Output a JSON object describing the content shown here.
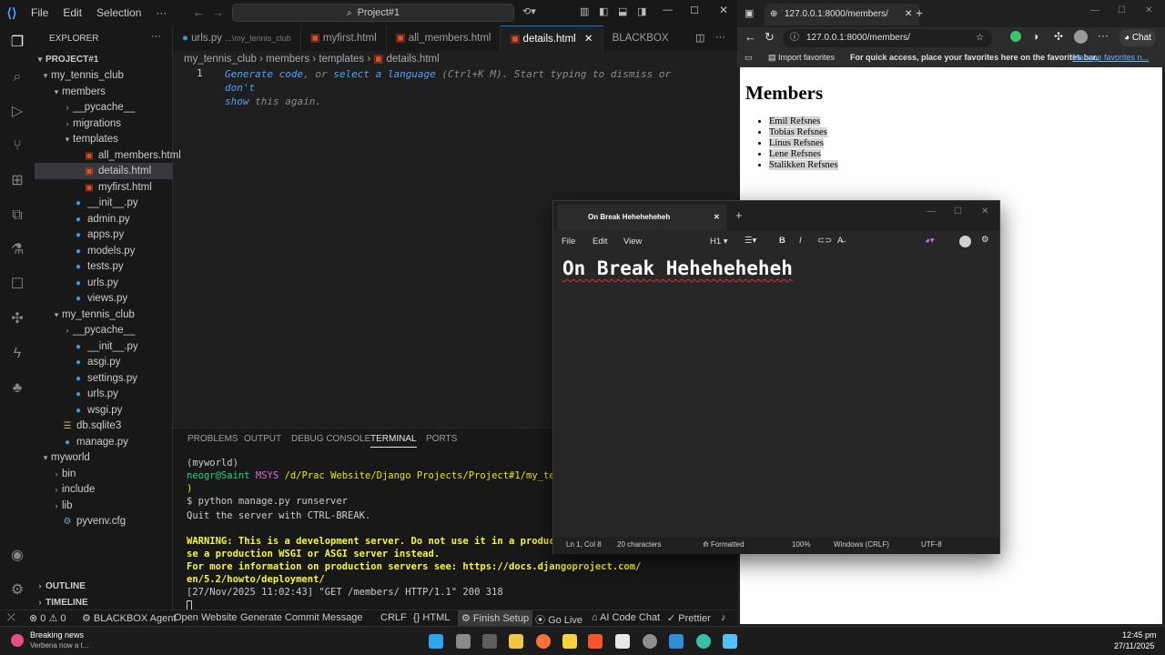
{
  "vscode": {
    "menu": [
      "File",
      "Edit",
      "Selection",
      "···"
    ],
    "search_text": "Project#1",
    "explorer_label": "EXPLORER",
    "project_root": "PROJECT#1",
    "tree": [
      {
        "label": "my_tennis_club",
        "depth": 1,
        "type": "folder",
        "open": true
      },
      {
        "label": "members",
        "depth": 2,
        "type": "folder",
        "open": true
      },
      {
        "label": "__pycache__",
        "depth": 3,
        "type": "folder",
        "open": false
      },
      {
        "label": "migrations",
        "depth": 3,
        "type": "folder",
        "open": false
      },
      {
        "label": "templates",
        "depth": 3,
        "type": "folder",
        "open": true
      },
      {
        "label": "all_members.html",
        "depth": 4,
        "type": "html"
      },
      {
        "label": "details.html",
        "depth": 4,
        "type": "html",
        "selected": true
      },
      {
        "label": "myfirst.html",
        "depth": 4,
        "type": "html"
      },
      {
        "label": "__init__.py",
        "depth": 3,
        "type": "py"
      },
      {
        "label": "admin.py",
        "depth": 3,
        "type": "py"
      },
      {
        "label": "apps.py",
        "depth": 3,
        "type": "py"
      },
      {
        "label": "models.py",
        "depth": 3,
        "type": "py"
      },
      {
        "label": "tests.py",
        "depth": 3,
        "type": "py"
      },
      {
        "label": "urls.py",
        "depth": 3,
        "type": "py"
      },
      {
        "label": "views.py",
        "depth": 3,
        "type": "py"
      },
      {
        "label": "my_tennis_club",
        "depth": 2,
        "type": "folder",
        "open": true
      },
      {
        "label": "__pycache__",
        "depth": 3,
        "type": "folder",
        "open": false
      },
      {
        "label": "__init__.py",
        "depth": 3,
        "type": "py"
      },
      {
        "label": "asgi.py",
        "depth": 3,
        "type": "py"
      },
      {
        "label": "settings.py",
        "depth": 3,
        "type": "py"
      },
      {
        "label": "urls.py",
        "depth": 3,
        "type": "py"
      },
      {
        "label": "wsgi.py",
        "depth": 3,
        "type": "py"
      },
      {
        "label": "db.sqlite3",
        "depth": 2,
        "type": "db"
      },
      {
        "label": "manage.py",
        "depth": 2,
        "type": "py"
      },
      {
        "label": "myworld",
        "depth": 1,
        "type": "folder",
        "open": true
      },
      {
        "label": "bin",
        "depth": 2,
        "type": "folder",
        "open": false
      },
      {
        "label": "include",
        "depth": 2,
        "type": "folder",
        "open": false
      },
      {
        "label": "lib",
        "depth": 2,
        "type": "folder",
        "open": false
      },
      {
        "label": "pyvenv.cfg",
        "depth": 2,
        "type": "cfg"
      }
    ],
    "outline_label": "OUTLINE",
    "timeline_label": "TIMELINE",
    "tabs": [
      {
        "label": "urls.py",
        "sub": "...\\my_tennis_club"
      },
      {
        "label": "myfirst.html",
        "sub": ""
      },
      {
        "label": "all_members.html",
        "sub": ""
      },
      {
        "label": "details.html",
        "sub": "",
        "active": true
      },
      {
        "label": "BLACKBOX",
        "sub": ""
      }
    ],
    "breadcrumb": [
      "my_tennis_club",
      "members",
      "templates",
      "details.html"
    ],
    "editor": {
      "line_number": "1",
      "hint_parts": [
        "Generate code",
        ", or ",
        "select a language",
        " (Ctrl+K M). Start typing to dismiss or ",
        "don't",
        "show",
        " this again."
      ]
    },
    "panel_tabs": [
      "PROBLEMS",
      "OUTPUT",
      "DEBUG CONSOLE",
      "TERMINAL",
      "PORTS"
    ],
    "terminal": {
      "line1": "(myworld)",
      "user": "neogr@Saint",
      "msys": "MSYS",
      "path": "/d/Prac Website/Django Projects/Project#1/my_tenni",
      "paren": ")",
      "cmd": "$ python manage.py runserver",
      "quit": "Quit the server with CTRL-BREAK.",
      "warn1": "WARNING: This is a development server. Do not use it in a productio",
      "warn2": "se a production WSGI or ASGI server instead.",
      "info1": "For more information on production servers see: https://docs.djangoproject.com/",
      "info2": "en/5.2/howto/deployment/",
      "log": "[27/Nov/2025 11:02:43] \"GET /members/ HTTP/1.1\" 200 318"
    },
    "status": {
      "errors": "0",
      "warnings": "0",
      "blackbox": "BLACKBOX Agent",
      "open_website": "Open Website",
      "commit": "Generate Commit Message",
      "crlf": "CRLF",
      "lang": "HTML",
      "finish_setup": "Finish Setup",
      "go_live": "Go Live",
      "ai_chat": "AI Code Chat",
      "prettier": "Prettier"
    }
  },
  "browser": {
    "tab_title": "127.0.0.1:8000/members/",
    "url": "127.0.0.1:8000/members/",
    "chat_label": "Chat",
    "import_favorites": "Import favorites",
    "fav_hint": "For quick access, place your favorites here on the favorites bar.",
    "manage_favorites": "Manage favorites n...",
    "page": {
      "heading": "Members",
      "members": [
        "Emil Refsnes",
        "Tobias Refsnes",
        "Linus Refsnes",
        "Lene Refsnes",
        "Stalikken Refsnes"
      ]
    }
  },
  "notepad": {
    "tab_title": "On Break Heheheheheh",
    "menu": [
      "File",
      "Edit",
      "View"
    ],
    "heading_select": "H1",
    "content": "On Break Heheheheheh",
    "status": {
      "position": "Ln 1, Col 8",
      "chars": "20 characters",
      "formatted": "Formatted",
      "zoom": "100%",
      "eol": "Windows (CRLF)",
      "encoding": "UTF-8"
    }
  },
  "taskbar": {
    "news_title": "Breaking news",
    "news_sub": "Verbena now a t...",
    "time": "12:45 pm",
    "date": "27/11/2025"
  }
}
